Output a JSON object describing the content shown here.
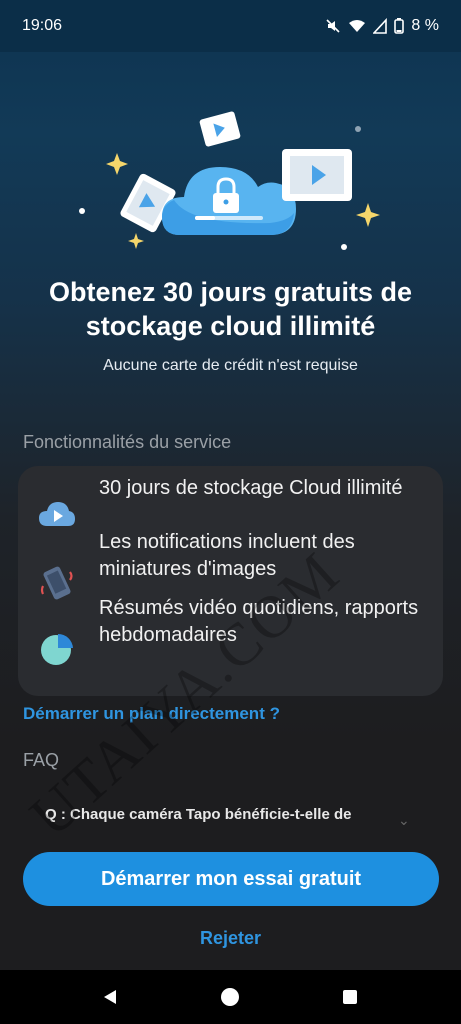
{
  "status_bar": {
    "time": "19:06",
    "battery": "8 %",
    "icons": [
      "mute-icon",
      "wifi-icon",
      "signal-icon",
      "battery-icon"
    ]
  },
  "promo": {
    "headline": "Obtenez 30 jours gratuits de stockage cloud illimité",
    "subline": "Aucune carte de crédit n'est requise"
  },
  "features": {
    "section_title": "Fonctionnalités du service",
    "items": [
      {
        "icon": "cloud-video-icon",
        "label": "30 jours de stockage Cloud illimité"
      },
      {
        "icon": "phone-notification-icon",
        "label": "Les notifications incluent des miniatures d'images"
      },
      {
        "icon": "pie-chart-icon",
        "label": "Résumés vidéo quotidiens, rapports hebdomadaires"
      }
    ]
  },
  "direct_plan_link": "Démarrer un plan directement ?",
  "faq": {
    "title": "FAQ",
    "question": "Q : Chaque caméra Tapo bénéficie-t-elle de"
  },
  "actions": {
    "start_trial": "Démarrer mon essai gratuit",
    "reject": "Rejeter"
  },
  "watermark": "UTAIYA.COM",
  "colors": {
    "accent": "#1e90e0",
    "link": "#2f95e0",
    "card_bg": "#2a2c30",
    "header_bg": "#0b2e48"
  }
}
